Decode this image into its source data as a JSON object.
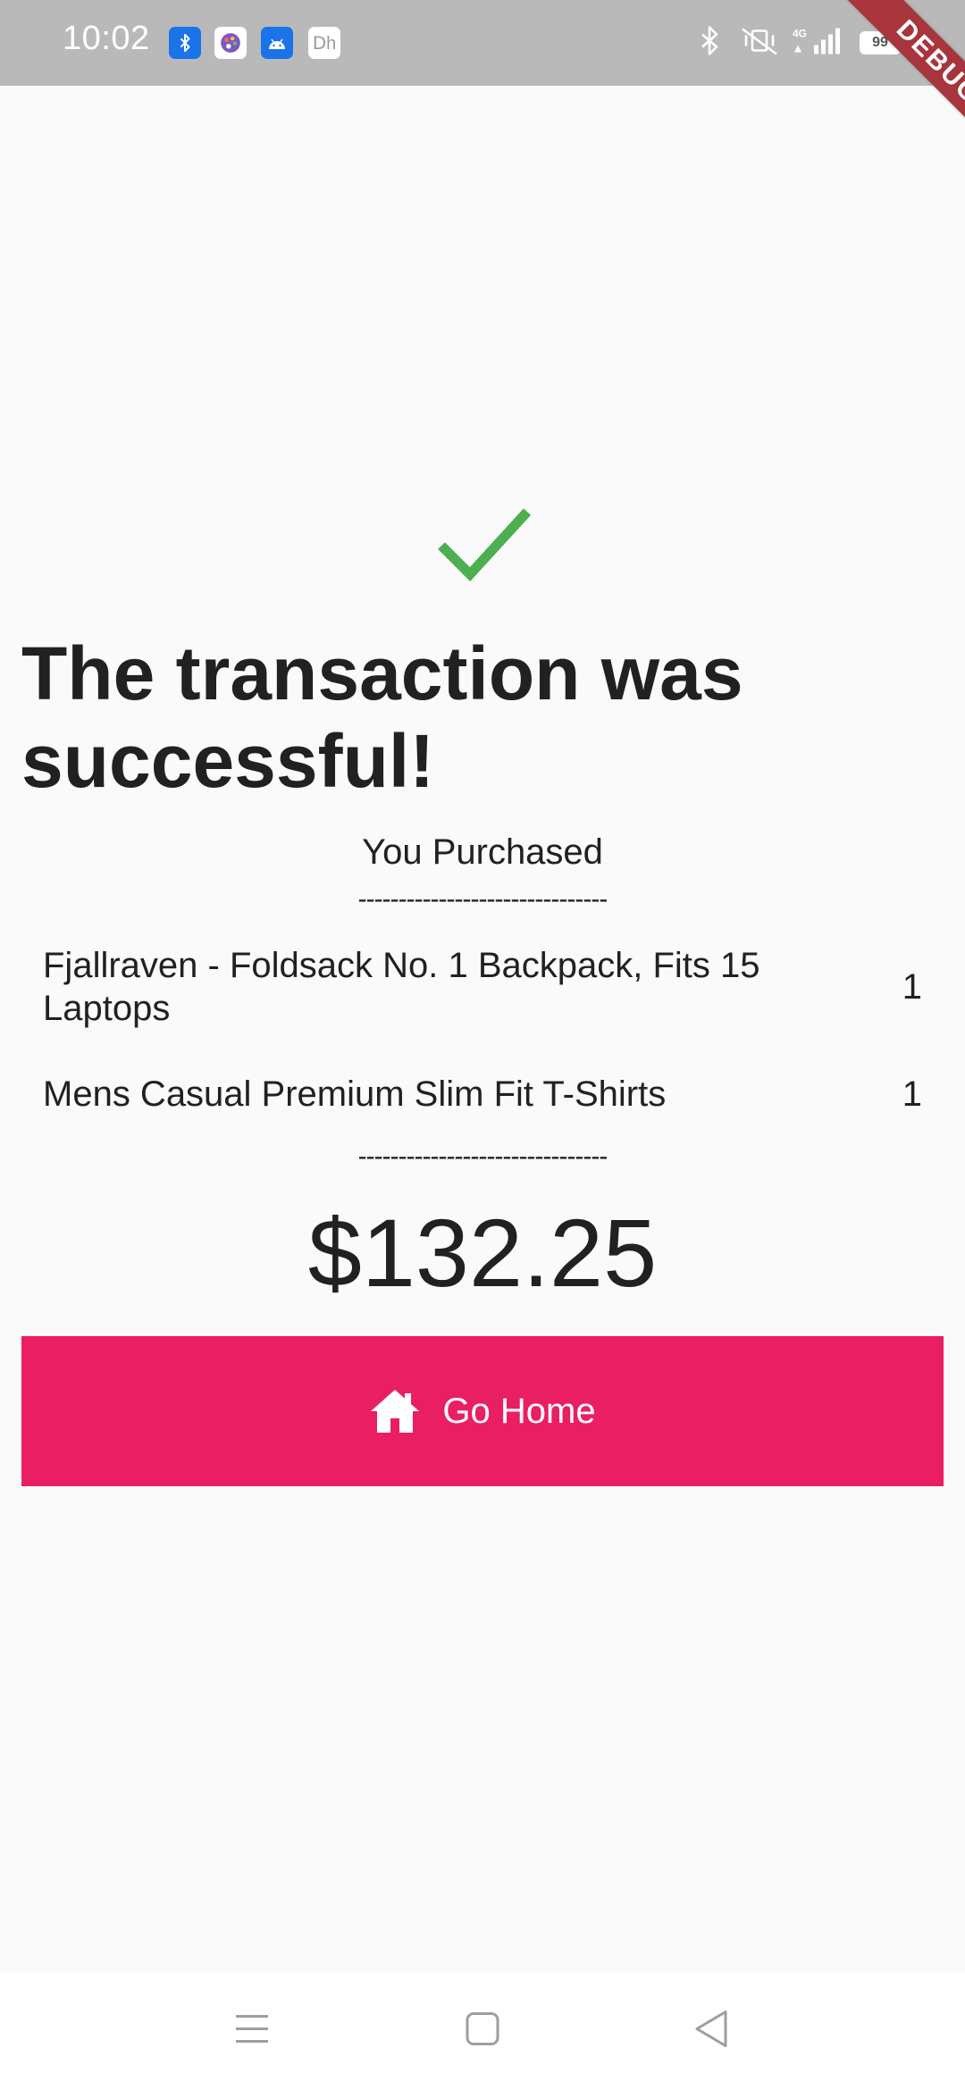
{
  "status_bar": {
    "time": "10:02",
    "notification_icons": [
      "bluetooth-app-icon",
      "palette-app-icon",
      "android-app-icon",
      "text-app-icon"
    ],
    "text_icon_label": "ᗞh",
    "battery_level": "99",
    "network_label": "4G"
  },
  "debug_banner": {
    "label": "DEBUG"
  },
  "success": {
    "icon": "check-icon",
    "icon_color": "#4caf50",
    "title": "The transaction was successful!"
  },
  "purchase": {
    "label": "You Purchased",
    "divider": "-------------------------------",
    "items": [
      {
        "name": "Fjallraven - Foldsack No. 1 Backpack, Fits 15 Laptops",
        "quantity": "1"
      },
      {
        "name": "Mens Casual Premium Slim Fit T-Shirts",
        "quantity": "1"
      }
    ],
    "total": "$132.25"
  },
  "actions": {
    "go_home_label": "Go Home",
    "go_home_icon": "home-icon",
    "button_color": "#e91e63"
  },
  "navigation": {
    "icons": [
      "menu-icon",
      "home-square-icon",
      "back-triangle-icon"
    ]
  }
}
